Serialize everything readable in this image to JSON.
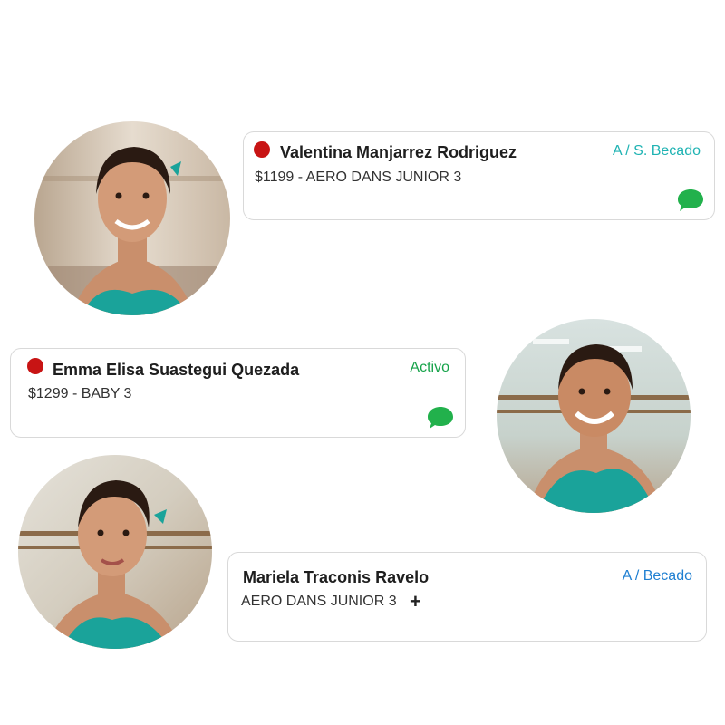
{
  "students": [
    {
      "name": "Valentina Manjarrez Rodriguez",
      "status": "A / S. Becado",
      "detail": "$1199 - AERO DANS JUNIOR 3",
      "has_alert": true,
      "has_chat": true
    },
    {
      "name": "Emma Elisa Suastegui Quezada",
      "status": "Activo",
      "detail": "$1299 - BABY 3",
      "has_alert": true,
      "has_chat": true
    },
    {
      "name": "Mariela Traconis Ravelo",
      "status": "A / Becado",
      "detail": "AERO DANS JUNIOR 3",
      "add_symbol": "+",
      "has_alert": false,
      "has_chat": false
    }
  ],
  "colors": {
    "alert_dot": "#c81414",
    "status_teal": "#1fb3b3",
    "status_green": "#16a34a",
    "status_blue": "#1f7fd1",
    "chat_green": "#22b14c",
    "leotard_teal": "#1aa39a"
  },
  "icons": {
    "alert": "red-dot-icon",
    "chat": "chat-bubble-icon",
    "add": "plus-icon"
  }
}
